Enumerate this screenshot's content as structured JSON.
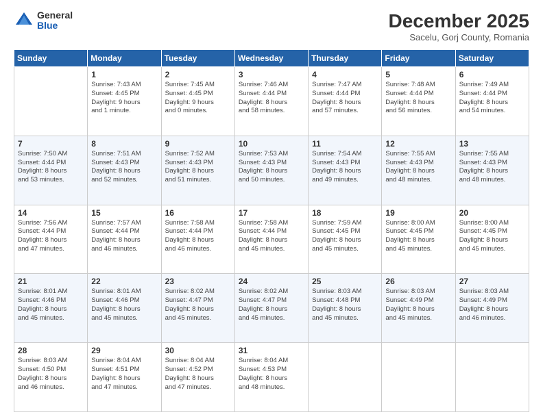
{
  "logo": {
    "general": "General",
    "blue": "Blue"
  },
  "header": {
    "month": "December 2025",
    "location": "Sacelu, Gorj County, Romania"
  },
  "days_of_week": [
    "Sunday",
    "Monday",
    "Tuesday",
    "Wednesday",
    "Thursday",
    "Friday",
    "Saturday"
  ],
  "weeks": [
    [
      {
        "day": "",
        "info": ""
      },
      {
        "day": "1",
        "info": "Sunrise: 7:43 AM\nSunset: 4:45 PM\nDaylight: 9 hours\nand 1 minute."
      },
      {
        "day": "2",
        "info": "Sunrise: 7:45 AM\nSunset: 4:45 PM\nDaylight: 9 hours\nand 0 minutes."
      },
      {
        "day": "3",
        "info": "Sunrise: 7:46 AM\nSunset: 4:44 PM\nDaylight: 8 hours\nand 58 minutes."
      },
      {
        "day": "4",
        "info": "Sunrise: 7:47 AM\nSunset: 4:44 PM\nDaylight: 8 hours\nand 57 minutes."
      },
      {
        "day": "5",
        "info": "Sunrise: 7:48 AM\nSunset: 4:44 PM\nDaylight: 8 hours\nand 56 minutes."
      },
      {
        "day": "6",
        "info": "Sunrise: 7:49 AM\nSunset: 4:44 PM\nDaylight: 8 hours\nand 54 minutes."
      }
    ],
    [
      {
        "day": "7",
        "info": "Sunrise: 7:50 AM\nSunset: 4:44 PM\nDaylight: 8 hours\nand 53 minutes."
      },
      {
        "day": "8",
        "info": "Sunrise: 7:51 AM\nSunset: 4:43 PM\nDaylight: 8 hours\nand 52 minutes."
      },
      {
        "day": "9",
        "info": "Sunrise: 7:52 AM\nSunset: 4:43 PM\nDaylight: 8 hours\nand 51 minutes."
      },
      {
        "day": "10",
        "info": "Sunrise: 7:53 AM\nSunset: 4:43 PM\nDaylight: 8 hours\nand 50 minutes."
      },
      {
        "day": "11",
        "info": "Sunrise: 7:54 AM\nSunset: 4:43 PM\nDaylight: 8 hours\nand 49 minutes."
      },
      {
        "day": "12",
        "info": "Sunrise: 7:55 AM\nSunset: 4:43 PM\nDaylight: 8 hours\nand 48 minutes."
      },
      {
        "day": "13",
        "info": "Sunrise: 7:55 AM\nSunset: 4:43 PM\nDaylight: 8 hours\nand 48 minutes."
      }
    ],
    [
      {
        "day": "14",
        "info": "Sunrise: 7:56 AM\nSunset: 4:44 PM\nDaylight: 8 hours\nand 47 minutes."
      },
      {
        "day": "15",
        "info": "Sunrise: 7:57 AM\nSunset: 4:44 PM\nDaylight: 8 hours\nand 46 minutes."
      },
      {
        "day": "16",
        "info": "Sunrise: 7:58 AM\nSunset: 4:44 PM\nDaylight: 8 hours\nand 46 minutes."
      },
      {
        "day": "17",
        "info": "Sunrise: 7:58 AM\nSunset: 4:44 PM\nDaylight: 8 hours\nand 45 minutes."
      },
      {
        "day": "18",
        "info": "Sunrise: 7:59 AM\nSunset: 4:45 PM\nDaylight: 8 hours\nand 45 minutes."
      },
      {
        "day": "19",
        "info": "Sunrise: 8:00 AM\nSunset: 4:45 PM\nDaylight: 8 hours\nand 45 minutes."
      },
      {
        "day": "20",
        "info": "Sunrise: 8:00 AM\nSunset: 4:45 PM\nDaylight: 8 hours\nand 45 minutes."
      }
    ],
    [
      {
        "day": "21",
        "info": "Sunrise: 8:01 AM\nSunset: 4:46 PM\nDaylight: 8 hours\nand 45 minutes."
      },
      {
        "day": "22",
        "info": "Sunrise: 8:01 AM\nSunset: 4:46 PM\nDaylight: 8 hours\nand 45 minutes."
      },
      {
        "day": "23",
        "info": "Sunrise: 8:02 AM\nSunset: 4:47 PM\nDaylight: 8 hours\nand 45 minutes."
      },
      {
        "day": "24",
        "info": "Sunrise: 8:02 AM\nSunset: 4:47 PM\nDaylight: 8 hours\nand 45 minutes."
      },
      {
        "day": "25",
        "info": "Sunrise: 8:03 AM\nSunset: 4:48 PM\nDaylight: 8 hours\nand 45 minutes."
      },
      {
        "day": "26",
        "info": "Sunrise: 8:03 AM\nSunset: 4:49 PM\nDaylight: 8 hours\nand 45 minutes."
      },
      {
        "day": "27",
        "info": "Sunrise: 8:03 AM\nSunset: 4:49 PM\nDaylight: 8 hours\nand 46 minutes."
      }
    ],
    [
      {
        "day": "28",
        "info": "Sunrise: 8:03 AM\nSunset: 4:50 PM\nDaylight: 8 hours\nand 46 minutes."
      },
      {
        "day": "29",
        "info": "Sunrise: 8:04 AM\nSunset: 4:51 PM\nDaylight: 8 hours\nand 47 minutes."
      },
      {
        "day": "30",
        "info": "Sunrise: 8:04 AM\nSunset: 4:52 PM\nDaylight: 8 hours\nand 47 minutes."
      },
      {
        "day": "31",
        "info": "Sunrise: 8:04 AM\nSunset: 4:53 PM\nDaylight: 8 hours\nand 48 minutes."
      },
      {
        "day": "",
        "info": ""
      },
      {
        "day": "",
        "info": ""
      },
      {
        "day": "",
        "info": ""
      }
    ]
  ]
}
